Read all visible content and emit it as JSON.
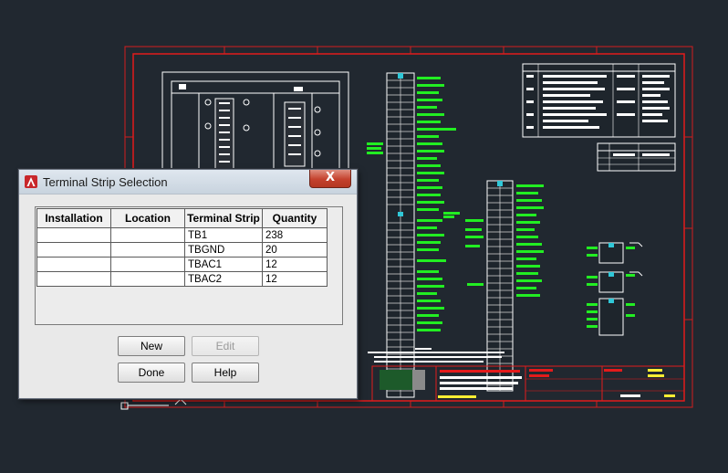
{
  "dialog": {
    "title": "Terminal Strip Selection",
    "close_label": "X",
    "columns": [
      "Installation",
      "Location",
      "Terminal Strip",
      "Quantity"
    ],
    "rows": [
      {
        "installation": "",
        "location": "",
        "strip": "TB1",
        "quantity": "238"
      },
      {
        "installation": "",
        "location": "",
        "strip": "TBGND",
        "quantity": "20"
      },
      {
        "installation": "",
        "location": "",
        "strip": "TBAC1",
        "quantity": "12"
      },
      {
        "installation": "",
        "location": "",
        "strip": "TBAC2",
        "quantity": "12"
      }
    ],
    "buttons": {
      "new": "New",
      "edit": "Edit",
      "done": "Done",
      "help": "Help"
    }
  },
  "colors": {
    "background": "#212830",
    "drawing_border": "#e31b1b",
    "wires": "#ffffff",
    "labels": "#22ee22",
    "accent": "#30c8d8"
  },
  "icons": [
    "autocad-app-icon",
    "ucs-icon"
  ]
}
